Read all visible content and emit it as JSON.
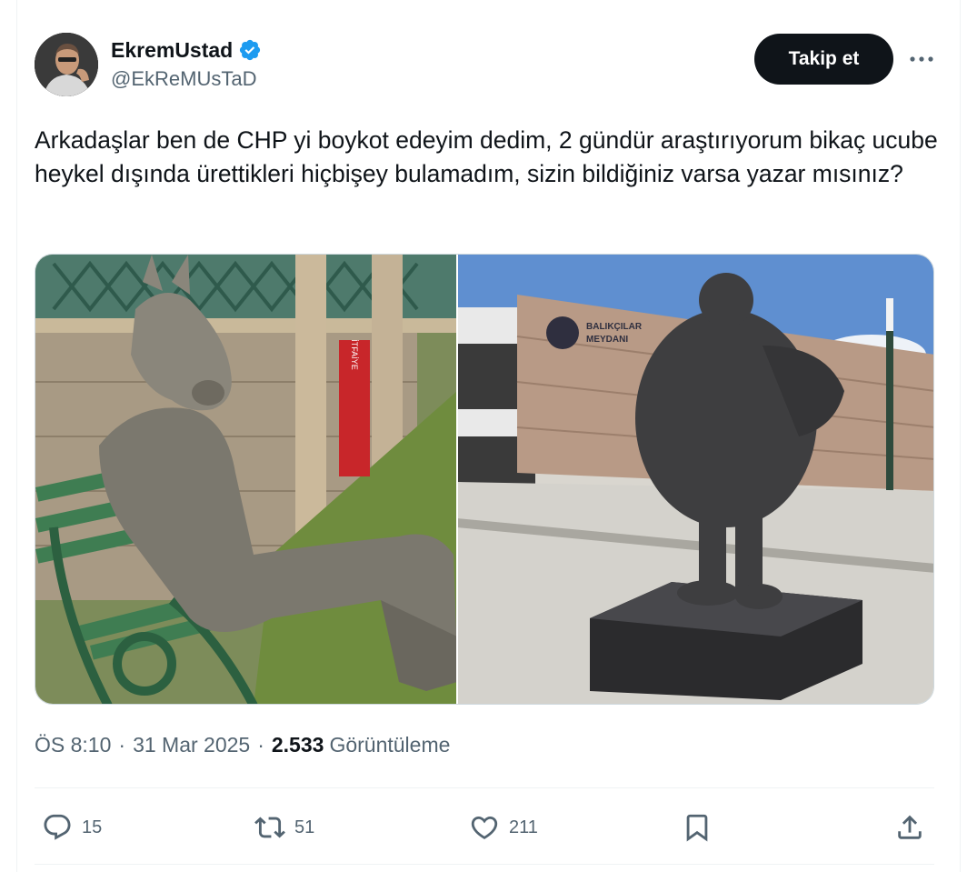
{
  "user": {
    "display_name": "EkremUstad",
    "handle": "@EkReMUsTaD",
    "verified": true,
    "verified_color": "#1d9bf0"
  },
  "follow_button": {
    "label": "Takip et"
  },
  "more_button": {
    "icon": "more-dots-icon"
  },
  "tweet": {
    "text": "Arkadaşlar ben de CHP yi boykot edeyim dedim, 2 gündür araştırıyorum bikaç ucube heykel dışında ürettikleri hiçbişey bulamadım, sizin bildiğiniz varsa yazar mısınız?"
  },
  "media": {
    "left_sign_text": "İTFAİYE",
    "right_sign_text_1": "BALIKÇILAR",
    "right_sign_text_2": "MEYDANI"
  },
  "meta": {
    "time": "ÖS 8:10",
    "date": "31 Mar 2025",
    "views_count": "2.533",
    "views_label": "Görüntüleme",
    "separator": "·"
  },
  "actions": {
    "replies": {
      "icon": "reply-icon",
      "count": "15"
    },
    "retweets": {
      "icon": "retweet-icon",
      "count": "51"
    },
    "likes": {
      "icon": "heart-icon",
      "count": "211"
    },
    "bookmark": {
      "icon": "bookmark-icon"
    },
    "share": {
      "icon": "share-icon"
    }
  },
  "colors": {
    "text_primary": "#0f1419",
    "text_secondary": "#536471",
    "border": "#eff3f4"
  }
}
